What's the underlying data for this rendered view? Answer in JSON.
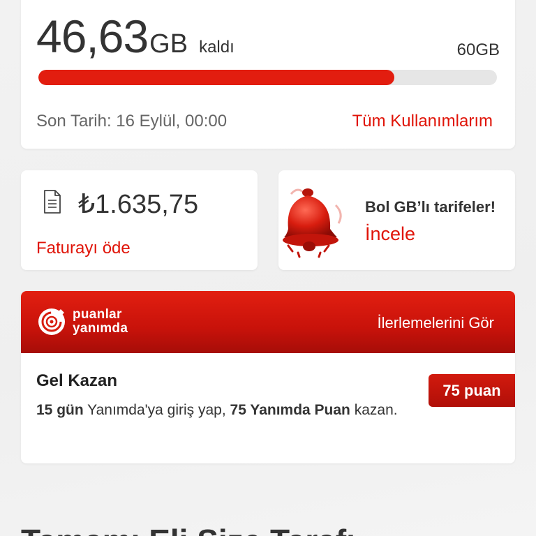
{
  "data_usage": {
    "remaining_value": "46,63",
    "remaining_unit": "GB",
    "remaining_label": "kaldı",
    "total": "60GB",
    "used_fraction": 0.777,
    "due_date": "Son Tarih: 16 Eylül, 00:00",
    "all_usage_link": "Tüm Kullanımlarım"
  },
  "bill": {
    "icon": "document-icon",
    "amount": "₺1.635,75",
    "pay_link": "Faturayı öde"
  },
  "promo": {
    "icon": "bell-icon",
    "title": "Bol GB’lı tarifeler!",
    "link": "İncele"
  },
  "points": {
    "logo_icon": "puanlar-yanimda-logo",
    "logo_line1": "puanlar",
    "logo_line2": "yanımda",
    "progress_link": "İlerlemelerini Gör",
    "challenge_title": "Gel Kazan",
    "desc_days": "15 gün",
    "desc_mid": " Yanımda'ya giriş yap, ",
    "desc_points": "75 Yanımda Puan",
    "desc_end": " kazan.",
    "badge": "75 puan"
  },
  "bottom": {
    "heading_partial": "Tamamı Eli Size Tarafı"
  },
  "colors": {
    "brand_red": "#e01408",
    "bar_track": "#e6e6e6"
  }
}
